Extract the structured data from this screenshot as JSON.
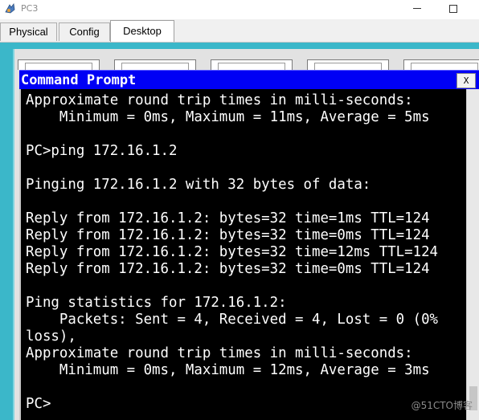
{
  "window": {
    "title": "PC3",
    "minimize_label": "",
    "maximize_label": ""
  },
  "tabs": [
    {
      "label": "Physical",
      "active": false
    },
    {
      "label": "Config",
      "active": false
    },
    {
      "label": "Desktop",
      "active": true
    }
  ],
  "command_prompt": {
    "title": "Command Prompt",
    "close_label": "X",
    "lines": [
      "Approximate round trip times in milli-seconds:",
      "    Minimum = 0ms, Maximum = 11ms, Average = 5ms",
      "",
      "PC>ping 172.16.1.2",
      "",
      "Pinging 172.16.1.2 with 32 bytes of data:",
      "",
      "Reply from 172.16.1.2: bytes=32 time=1ms TTL=124",
      "Reply from 172.16.1.2: bytes=32 time=0ms TTL=124",
      "Reply from 172.16.1.2: bytes=32 time=12ms TTL=124",
      "Reply from 172.16.1.2: bytes=32 time=0ms TTL=124",
      "",
      "Ping statistics for 172.16.1.2:",
      "    Packets: Sent = 4, Received = 4, Lost = 0 (0%",
      "loss),",
      "Approximate round trip times in milli-seconds:",
      "    Minimum = 0ms, Maximum = 12ms, Average = 3ms",
      "",
      "PC>"
    ]
  },
  "watermark": "@51CTO博客",
  "colors": {
    "desktop_bg": "#3bb7c9",
    "cmd_title_bg": "#0000f5",
    "console_bg": "#000000",
    "console_fg": "#ffffff"
  }
}
